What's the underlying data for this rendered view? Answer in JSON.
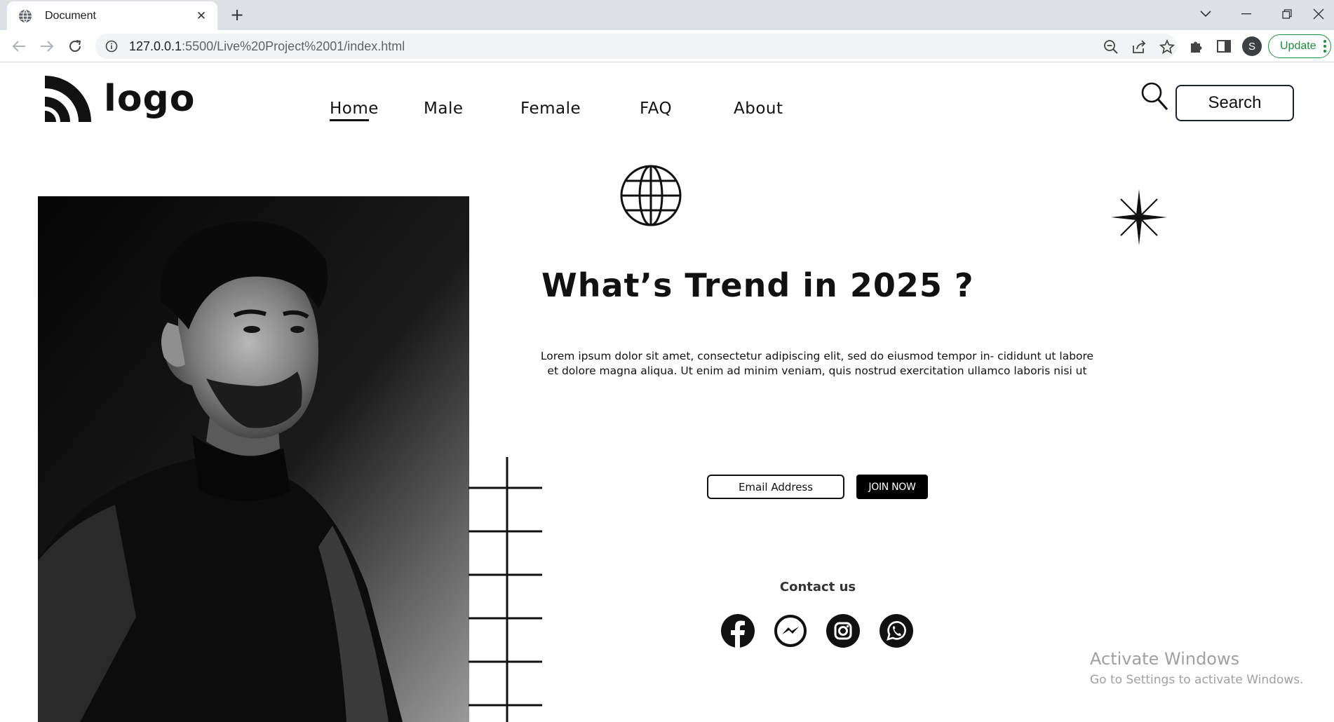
{
  "browser": {
    "tab_title": "Document",
    "url_host": "127.0.0.1",
    "url_path": ":5500/Live%20Project%2001/index.html",
    "profile_initial": "S",
    "update_label": "Update"
  },
  "header": {
    "logo_text": "logo",
    "nav": [
      {
        "label": "Home",
        "active": true
      },
      {
        "label": "Male",
        "active": false
      },
      {
        "label": "Female",
        "active": false
      },
      {
        "label": "FAQ",
        "active": false
      },
      {
        "label": "About",
        "active": false
      }
    ],
    "search_label": "Search"
  },
  "hero": {
    "headline": "What’s Trend in 2025 ?",
    "body": "Lorem ipsum dolor sit amet, consectetur adipiscing elit, sed do eiusmod tempor in- cididunt ut labore et dolore magna aliqua. Ut enim ad minim veniam, quis nostrud exercitation ullamco laboris nisi ut"
  },
  "signup": {
    "email_placeholder": "Email Address",
    "join_label": "JOIN NOW"
  },
  "contact": {
    "title": "Contact us",
    "icons": [
      "facebook-icon",
      "messenger-icon",
      "instagram-icon",
      "whatsapp-icon"
    ]
  },
  "watermark": {
    "line1": "Activate Windows",
    "line2": "Go to Settings to activate Windows."
  }
}
